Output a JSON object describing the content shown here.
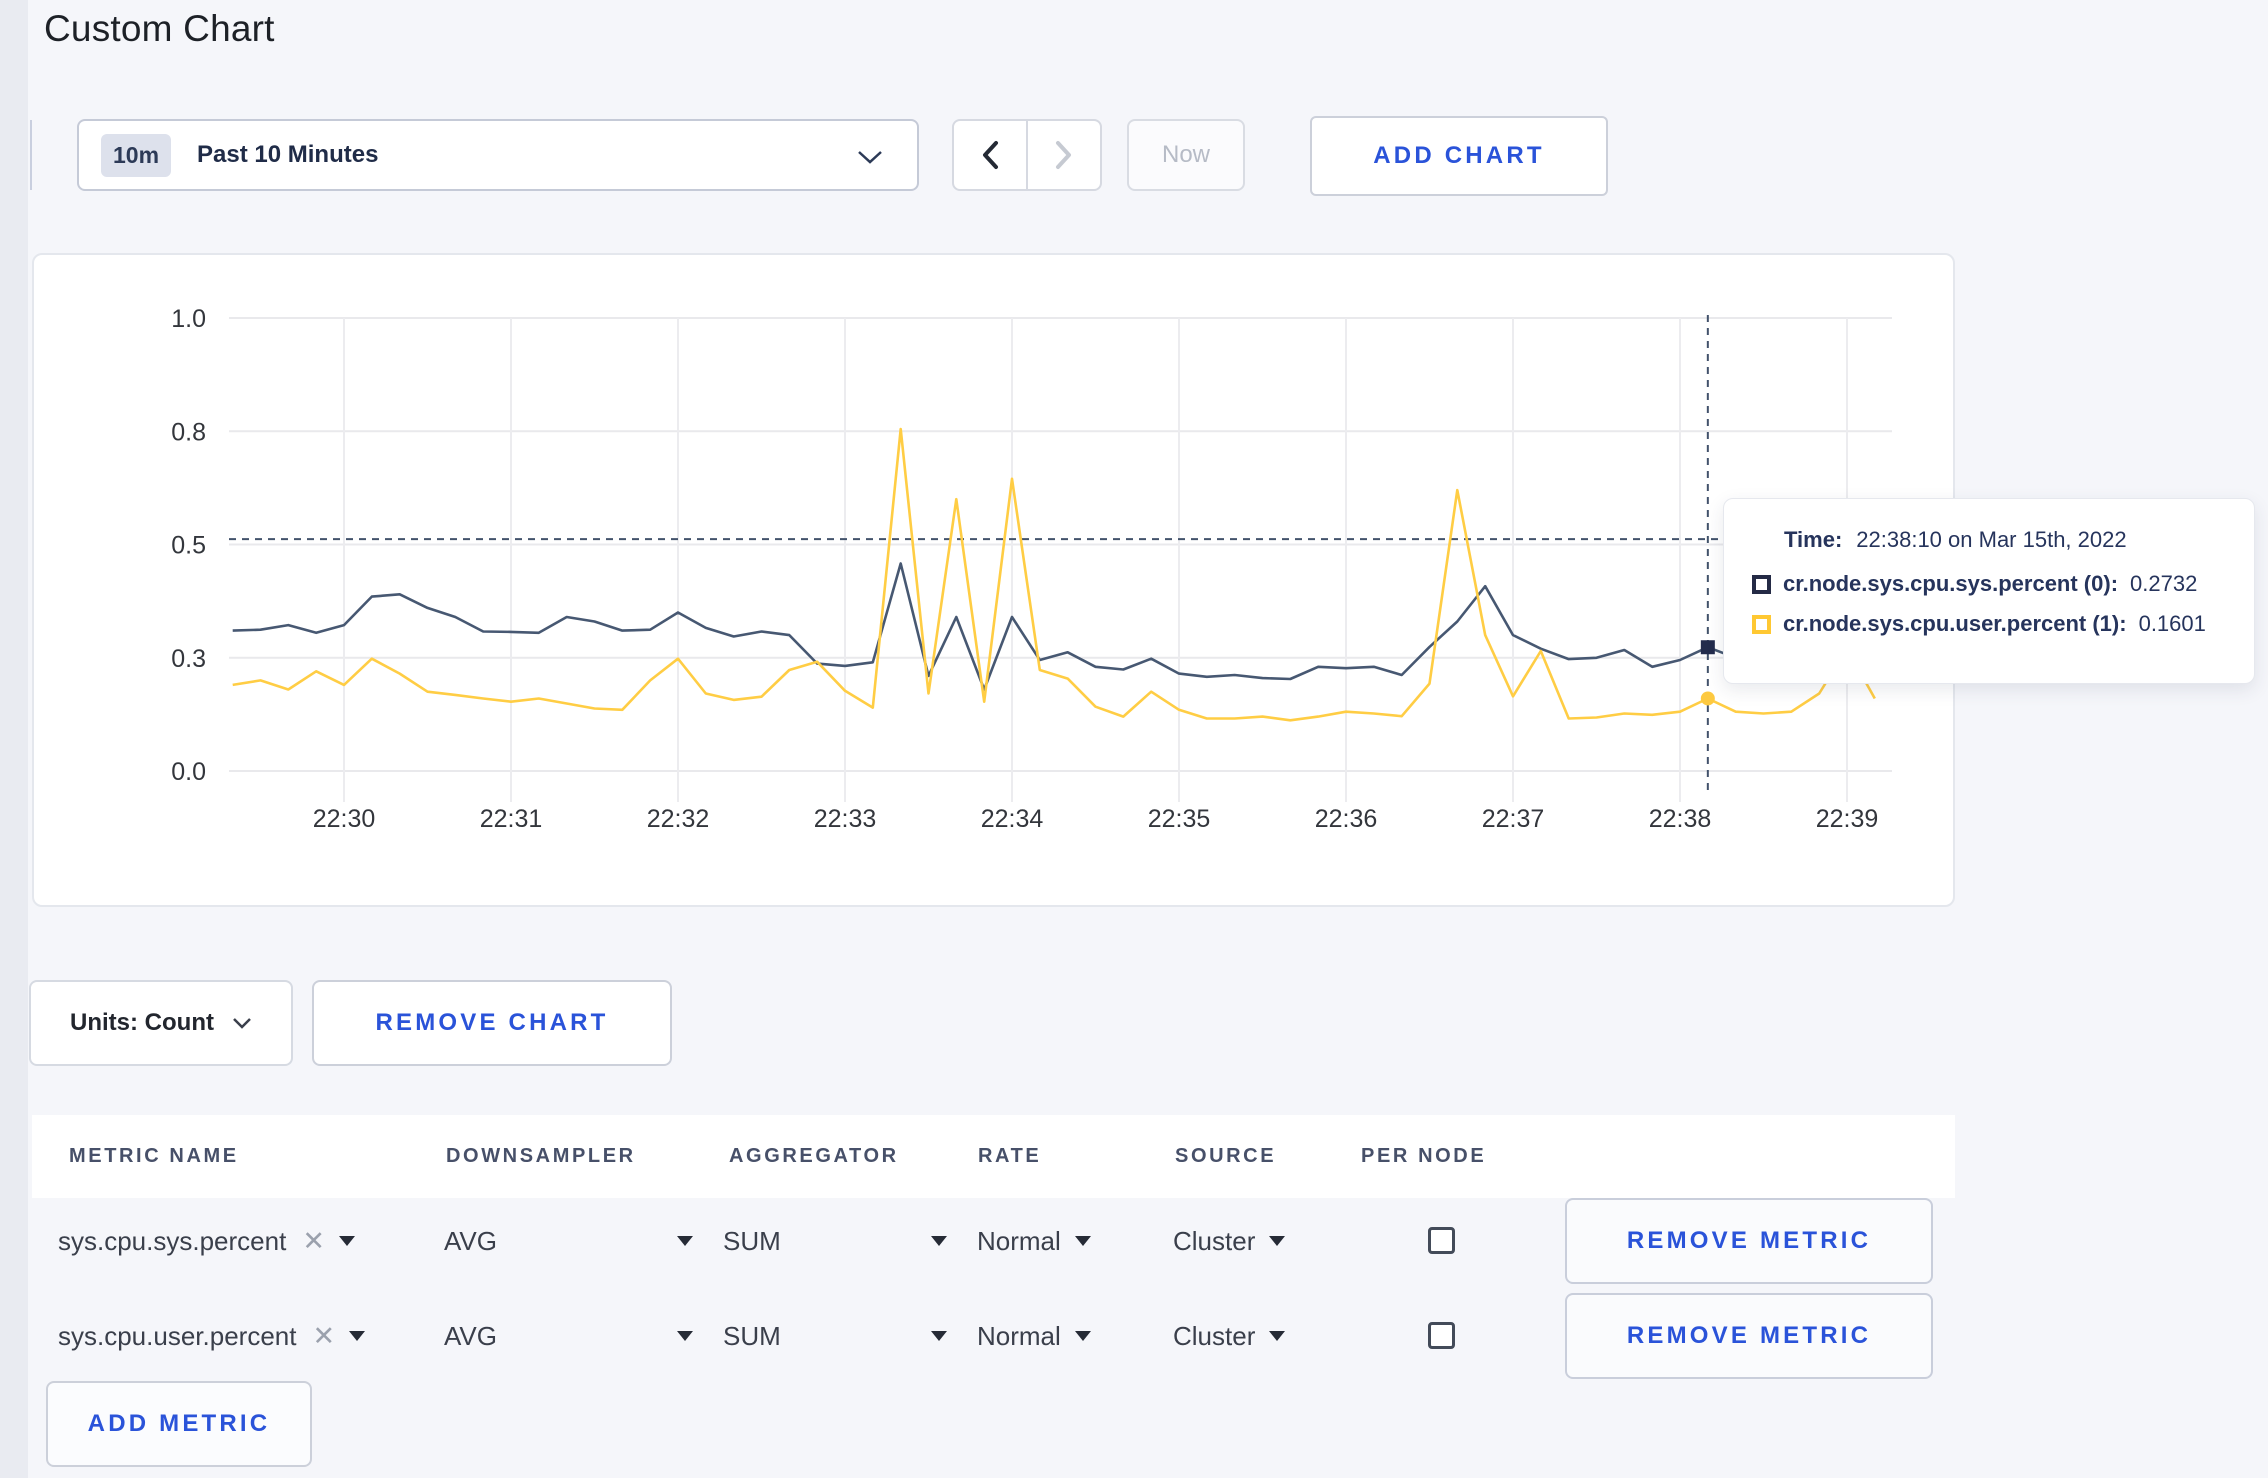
{
  "page": {
    "title": "Custom Chart"
  },
  "accent_blue": "#2a53d9",
  "icons": {
    "clear": "✕"
  },
  "toolbar": {
    "range_badge": "10m",
    "range_label": "Past 10 Minutes",
    "prev_label": "previous-range",
    "next_label": "next-range",
    "now_label": "Now",
    "add_chart_label": "ADD CHART"
  },
  "chart_data": {
    "type": "line",
    "title": "",
    "xlabel": "",
    "ylabel": "",
    "ylim": [
      0,
      1
    ],
    "grid": true,
    "x_start_time": "22:29:20",
    "x_interval_seconds": 10,
    "x_tick_labels": [
      "22:30",
      "22:31",
      "22:32",
      "22:33",
      "22:34",
      "22:35",
      "22:36",
      "22:37",
      "22:38",
      "22:39"
    ],
    "y_ticks": [
      {
        "value": 1.0,
        "label": "1.0"
      },
      {
        "value": 0.75,
        "label": "0.8"
      },
      {
        "value": 0.5,
        "label": "0.5"
      },
      {
        "value": 0.25,
        "label": "0.3"
      },
      {
        "value": 0.0,
        "label": "0.0"
      }
    ],
    "series": [
      {
        "name": "cr.node.sys.cpu.sys.percent",
        "color": "#475872",
        "values": [
          0.31,
          0.312,
          0.322,
          0.305,
          0.322,
          0.385,
          0.39,
          0.36,
          0.34,
          0.308,
          0.307,
          0.305,
          0.34,
          0.33,
          0.31,
          0.312,
          0.35,
          0.316,
          0.297,
          0.308,
          0.3,
          0.237,
          0.232,
          0.24,
          0.458,
          0.21,
          0.34,
          0.18,
          0.34,
          0.245,
          0.262,
          0.23,
          0.224,
          0.248,
          0.215,
          0.208,
          0.212,
          0.205,
          0.203,
          0.23,
          0.227,
          0.23,
          0.212,
          0.274,
          0.33,
          0.408,
          0.3,
          0.27,
          0.247,
          0.25,
          0.267,
          0.23,
          0.245,
          0.2732,
          0.25,
          0.3,
          0.31,
          0.3,
          0.31,
          0.3
        ]
      },
      {
        "name": "cr.node.sys.cpu.user.percent",
        "color": "#ffcd44",
        "values": [
          0.19,
          0.2,
          0.18,
          0.22,
          0.19,
          0.248,
          0.215,
          0.175,
          0.168,
          0.16,
          0.153,
          0.16,
          0.149,
          0.138,
          0.135,
          0.2,
          0.248,
          0.171,
          0.157,
          0.164,
          0.223,
          0.241,
          0.177,
          0.14,
          0.755,
          0.171,
          0.6,
          0.153,
          0.645,
          0.223,
          0.204,
          0.142,
          0.12,
          0.175,
          0.135,
          0.116,
          0.116,
          0.12,
          0.112,
          0.12,
          0.131,
          0.127,
          0.121,
          0.193,
          0.62,
          0.3,
          0.165,
          0.265,
          0.116,
          0.118,
          0.127,
          0.124,
          0.131,
          0.1601,
          0.131,
          0.127,
          0.131,
          0.171,
          0.27,
          0.16
        ]
      }
    ],
    "crosshair": {
      "time": "22:38:10",
      "index": 53,
      "hline_value": 0.512,
      "highlight_values": [
        0.2732,
        0.1601
      ],
      "color": "#42526b"
    }
  },
  "tooltip": {
    "time_label": "Time:",
    "time_value": "22:38:10 on Mar 15th, 2022",
    "rows": [
      {
        "name": "cr.node.sys.cpu.sys.percent (0):",
        "value": "0.2732",
        "swatch": "#242a45"
      },
      {
        "name": "cr.node.sys.cpu.user.percent (1):",
        "value": "0.1601",
        "swatch": "#ffc832"
      }
    ]
  },
  "chart_controls": {
    "units_label": "Units: Count",
    "remove_chart_label": "REMOVE CHART"
  },
  "metrics_table": {
    "columns": [
      "METRIC NAME",
      "DOWNSAMPLER",
      "AGGREGATOR",
      "RATE",
      "SOURCE",
      "PER NODE"
    ],
    "rows": [
      {
        "metric": "sys.cpu.sys.percent",
        "downsampler": "AVG",
        "aggregator": "SUM",
        "rate": "Normal",
        "source": "Cluster",
        "per_node_checked": false,
        "remove_label": "REMOVE METRIC"
      },
      {
        "metric": "sys.cpu.user.percent",
        "downsampler": "AVG",
        "aggregator": "SUM",
        "rate": "Normal",
        "source": "Cluster",
        "per_node_checked": false,
        "remove_label": "REMOVE METRIC"
      }
    ],
    "add_metric_label": "ADD METRIC"
  }
}
